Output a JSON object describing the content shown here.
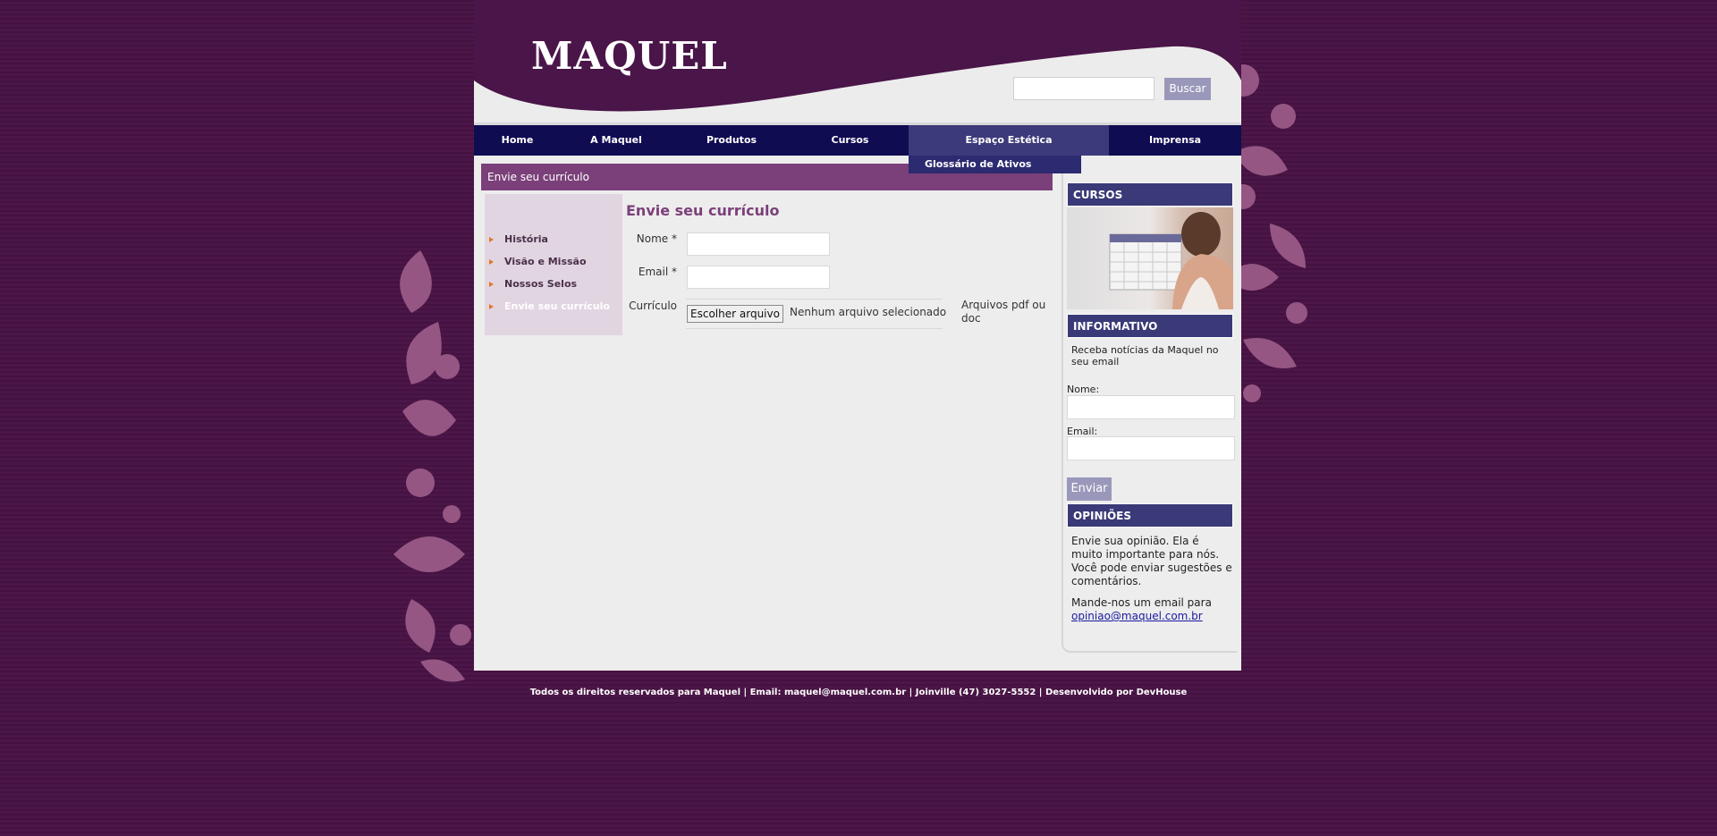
{
  "brand": {
    "logo": "MAQUEL"
  },
  "search": {
    "placeholder": "",
    "button": "Buscar"
  },
  "nav": {
    "items": [
      {
        "label": "Home"
      },
      {
        "label": "A Maquel"
      },
      {
        "label": "Produtos"
      },
      {
        "label": "Cursos"
      },
      {
        "label": "Espaço Estética"
      },
      {
        "label": "Imprensa"
      }
    ],
    "submenu": {
      "label": "Glossário de Ativos"
    }
  },
  "main": {
    "title_bar": "Envie seu currículo",
    "left_nav": [
      {
        "label": "História"
      },
      {
        "label": "Visão e Missão"
      },
      {
        "label": "Nossos Selos"
      },
      {
        "label": "Envie seu currículo"
      }
    ],
    "form": {
      "title": "Envie seu currículo",
      "name_label": "Nome *",
      "email_label": "Email *",
      "cv_label": "Currículo",
      "file_button": "Escolher arquivo",
      "file_status": "Nenhum arquivo selecionado",
      "file_hint": "Arquivos pdf ou doc"
    }
  },
  "sidebar": {
    "cursos": {
      "title": "CURSOS"
    },
    "informativo": {
      "title": "INFORMATIVO",
      "text": "Receba notícias da Maquel no seu email",
      "name_label": "Nome:",
      "email_label": "Email:",
      "button": "Enviar"
    },
    "opinioes": {
      "title": "OPINIÕES",
      "text": "Envie sua opinião. Ela é muito importante para nós. Você pode enviar sugestões e comentários.",
      "mail_text": "Mande-nos um email para",
      "mail_link": "opiniao@maquel.com.br"
    }
  },
  "footer": {
    "text": "Todos os direitos reservados para Maquel | Email: maquel@maquel.com.br | Joinville (47) 3027-5552 | Desenvolvido por DevHouse"
  },
  "colors": {
    "background": "#4a1548",
    "nav": "#0f0c52",
    "title_bar": "#7b4079",
    "side_head": "#3a3a78",
    "button": "#9a98ba"
  }
}
